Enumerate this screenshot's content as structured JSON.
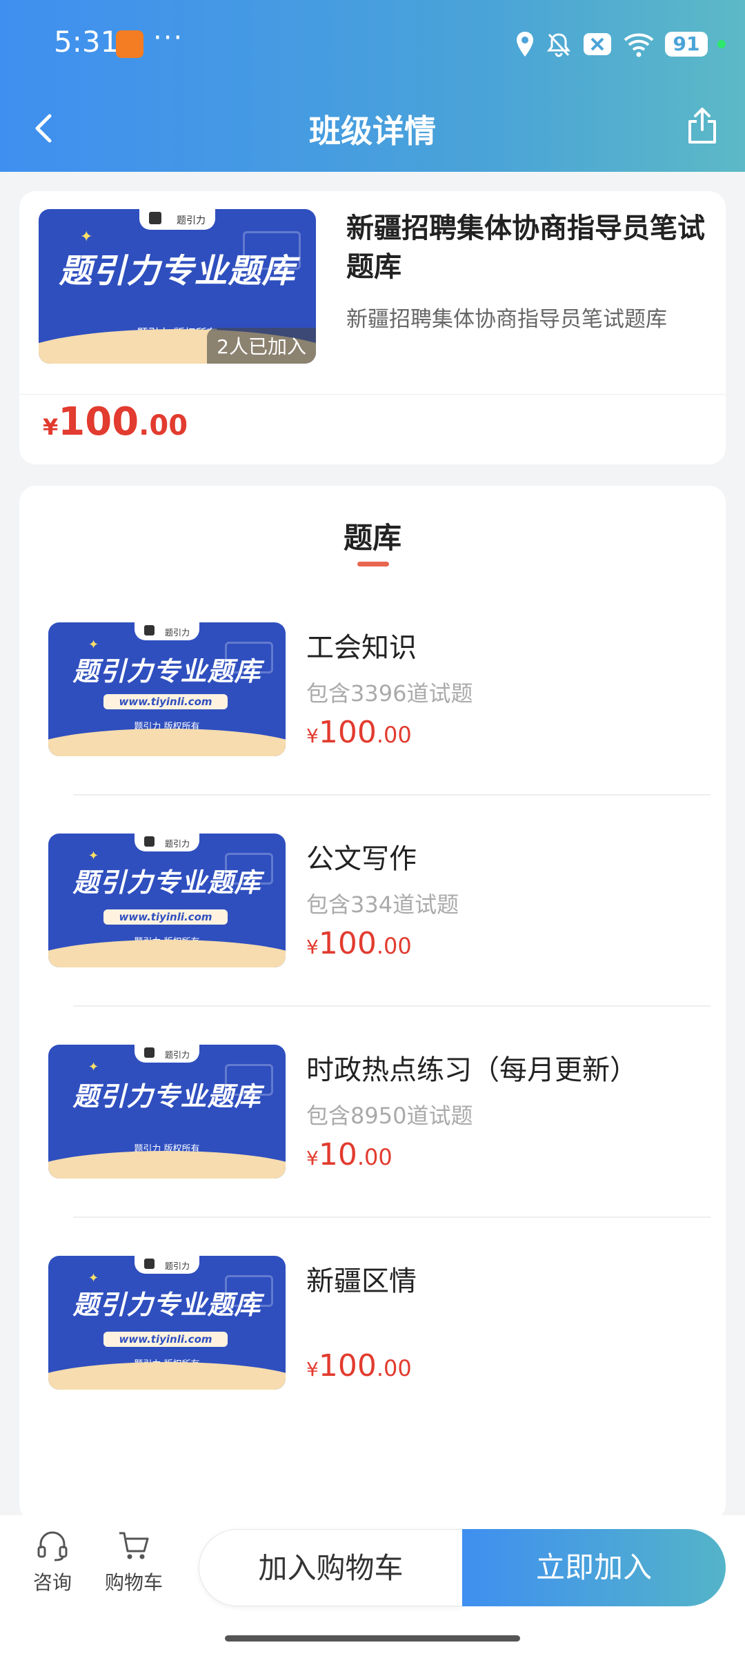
{
  "status_bar": {
    "time": "5:31",
    "dots": "···",
    "battery": "91"
  },
  "nav": {
    "title": "班级详情"
  },
  "class_card": {
    "title": "新疆招聘集体协商指导员笔试题库",
    "subtitle": "新疆招聘集体协商指导员笔试题库",
    "joined": "2人已加入",
    "price_symbol": "¥",
    "price_int": "100",
    "price_dec": ".00",
    "cover": {
      "tab_text": "题引力",
      "headline": "题引力专业题库",
      "rights": "题引力 版权所有"
    }
  },
  "section": {
    "title": "题库"
  },
  "cover_common": {
    "tab_text": "题引力",
    "headline": "题引力专业题库",
    "url": "www.tiyinli.com",
    "rights": "题引力 版权所有"
  },
  "items": [
    {
      "name": "工会知识",
      "count": "包含3396道试题",
      "price_symbol": "¥",
      "price_int": "100",
      "price_dec": ".00"
    },
    {
      "name": "公文写作",
      "count": "包含334道试题",
      "price_symbol": "¥",
      "price_int": "100",
      "price_dec": ".00"
    },
    {
      "name": "时政热点练习（每月更新）",
      "count": "包含8950道试题",
      "price_symbol": "¥",
      "price_int": "10",
      "price_dec": ".00"
    },
    {
      "name": "新疆区情",
      "count": "",
      "price_symbol": "¥",
      "price_int": "100",
      "price_dec": ".00"
    }
  ],
  "bottom_bar": {
    "consult_label": "咨询",
    "cart_label": "购物车",
    "add_cart_button": "加入购物车",
    "join_now_button": "立即加入"
  },
  "colors": {
    "header_gradient_start": "#3f8ff0",
    "header_gradient_end": "#5cb9c6",
    "price_red": "#e23b2f",
    "cover_blue": "#2f4fbf",
    "tab_indicator": "#e8664f"
  }
}
